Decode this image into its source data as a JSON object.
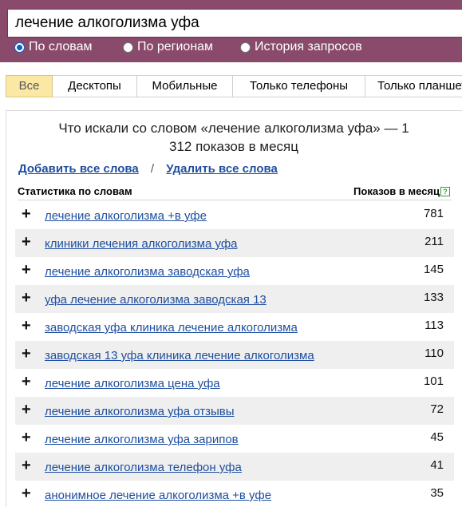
{
  "search": {
    "query": "лечение алкоголизма уфа"
  },
  "modes": [
    {
      "label": "По словам",
      "checked": true
    },
    {
      "label": "По регионам",
      "checked": false
    },
    {
      "label": "История запросов",
      "checked": false
    }
  ],
  "tabs": [
    {
      "label": "Все",
      "active": true
    },
    {
      "label": "Десктопы",
      "active": false
    },
    {
      "label": "Мобильные",
      "active": false
    },
    {
      "label": "Только телефоны",
      "active": false
    },
    {
      "label": "Только планшеты",
      "active": false
    }
  ],
  "results": {
    "title": "Что искали со словом «лечение алкоголизма уфа» — 1 312 показов в месяц",
    "add_all": "Добавить все слова",
    "separator": "/",
    "remove_all": "Удалить все слова",
    "col_words": "Статистика по словам",
    "col_impressions": "Показов в месяц",
    "help_icon": "?",
    "add_symbol": "+",
    "rows": [
      {
        "phrase": "лечение алкоголизма +в уфе",
        "count": "781"
      },
      {
        "phrase": "клиники лечения алкоголизма уфа",
        "count": "211"
      },
      {
        "phrase": "лечение алкоголизма заводская уфа",
        "count": "145"
      },
      {
        "phrase": "уфа лечение алкоголизма заводская 13",
        "count": "133"
      },
      {
        "phrase": "заводская уфа клиника лечение алкоголизма",
        "count": "113"
      },
      {
        "phrase": "заводская 13 уфа клиника лечение алкоголизма",
        "count": "110"
      },
      {
        "phrase": "лечение алкоголизма цена уфа",
        "count": "101"
      },
      {
        "phrase": "лечение алкоголизма уфа отзывы",
        "count": "72"
      },
      {
        "phrase": "лечение алкоголизма уфа зарипов",
        "count": "45"
      },
      {
        "phrase": "лечение алкоголизма телефон уфа",
        "count": "41"
      },
      {
        "phrase": "анонимное лечение алкоголизма +в уфе",
        "count": "35"
      }
    ]
  },
  "colors": {
    "header": "#8a4a6b",
    "link": "#1f4fa0",
    "active_tab": "#fbe8a5",
    "row_alt": "#efefef"
  }
}
